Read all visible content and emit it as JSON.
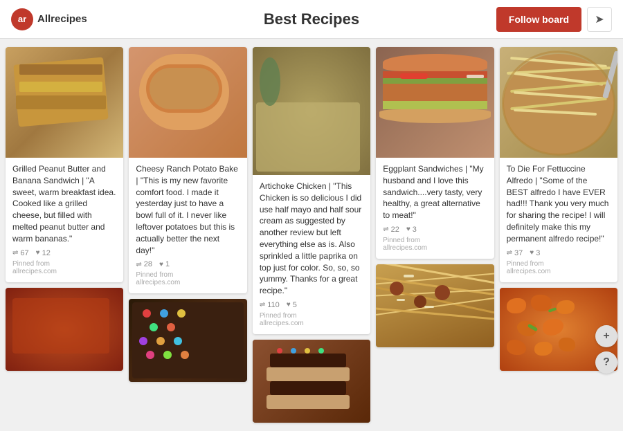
{
  "header": {
    "logo_text": "ar",
    "brand": "Allrecipes",
    "title": "Best Recipes",
    "follow_label": "Follow board",
    "send_icon": "➤"
  },
  "pins": [
    {
      "id": 1,
      "title": "Grilled Peanut Butter and Banana Sandwich | \"A sweet, warm breakfast idea. Cooked like a grilled cheese, but filled with melted peanut butter and warm bananas.\"",
      "repins": "67",
      "likes": "12",
      "pinned_from_label": "Pinned from",
      "source": "allrecipes.com",
      "bg": "#c8a060"
    },
    {
      "id": 2,
      "title": "Cheesy Ranch Potato Bake | \"This is my new favorite comfort food. I made it yesterday just to have a bowl full of it. I never like leftover potatoes but this is actually better the next day!\"",
      "repins": "28",
      "likes": "1",
      "pinned_from_label": "Pinned from",
      "source": "allrecipes.com",
      "bg": "#d4956e"
    },
    {
      "id": 3,
      "title": "Artichoke Chicken | \"This Chicken is so delicious I did use half mayo and half sour cream as suggested by another review but left everything else as is. Also sprinkled a little paprika on top just for color. So, so, so yummy. Thanks for a great recipe.\"",
      "repins": "110",
      "likes": "5",
      "pinned_from_label": "Pinned from",
      "source": "allrecipes.com",
      "bg": "#b0a878"
    },
    {
      "id": 4,
      "title": "Eggplant Sandwiches | \"My husband and I love this sandwich....very tasty, very healthy, a great alternative to meat!\"",
      "repins": "22",
      "likes": "3",
      "pinned_from_label": "Pinned from",
      "source": "allrecipes.com",
      "bg": "#8b6450"
    },
    {
      "id": 5,
      "title": "To Die For Fettuccine Alfredo | \"Some of the BEST alfredo I have EVER had!!! Thank you very much for sharing the recipe! I will definitely make this my permanent alfredo recipe!\"",
      "repins": "37",
      "likes": "3",
      "pinned_from_label": "Pinned from",
      "source": "allrecipes.com",
      "bg": "#c8b078"
    }
  ],
  "bottom_pins": [
    {
      "id": 6,
      "bg": "#d4602a"
    },
    {
      "id": 7,
      "bg": "#3a2010"
    },
    {
      "id": 8,
      "bg": "#8b5030"
    },
    {
      "id": 9,
      "bg": "#c8a060"
    },
    {
      "id": 10,
      "bg": "#e07828"
    }
  ],
  "side_buttons": {
    "plus": "+",
    "question": "?"
  }
}
